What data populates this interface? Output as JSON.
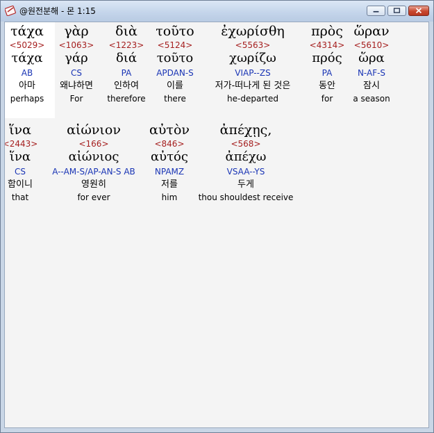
{
  "window": {
    "title": "@원전분해 - 몬 1:15",
    "controls": {
      "minimize": "minimize",
      "maximize": "maximize",
      "close": "close"
    }
  },
  "rows": [
    {
      "words": [
        {
          "greek": "τάχα",
          "strong": "<5029>",
          "lemma": "τάχα",
          "morph": "AB",
          "korean": "아마",
          "english": "perhaps"
        },
        {
          "greek": "γὰρ",
          "strong": "<1063>",
          "lemma": "γάρ",
          "morph": "CS",
          "korean": "왜냐하면",
          "english": "For"
        },
        {
          "greek": "διὰ",
          "strong": "<1223>",
          "lemma": "διά",
          "morph": "PA",
          "korean": "인하여",
          "english": "therefore"
        },
        {
          "greek": "τοῦτο",
          "strong": "<5124>",
          "lemma": "τοῦτο",
          "morph": "APDAN-S",
          "korean": "이를",
          "english": "there"
        },
        {
          "greek": "ἐχωρίσθη",
          "strong": "<5563>",
          "lemma": "χωρίζω",
          "morph": "VIAP--ZS",
          "korean": "저가-떠나게 된 것은",
          "english": "he-departed"
        },
        {
          "greek": "πρὸς",
          "strong": "<4314>",
          "lemma": "πρός",
          "morph": "PA",
          "korean": "동안",
          "english": "for"
        },
        {
          "greek": "ὥραν",
          "strong": "<5610>",
          "lemma": "ὥρα",
          "morph": "N-AF-S",
          "korean": "잠시",
          "english": "a season"
        }
      ]
    },
    {
      "words": [
        {
          "greek": "ἵνα",
          "strong": "<2443>",
          "lemma": "ἵνα",
          "morph": "CS",
          "korean": "함이니",
          "english": "that"
        },
        {
          "greek": "αἰώνιον",
          "strong": "<166>",
          "lemma": "αἰώνιος",
          "morph": "A--AM-S/AP-AN-S AB",
          "korean": "영원히",
          "english": "for ever"
        },
        {
          "greek": "αὐτὸν",
          "strong": "<846>",
          "lemma": "αὐτός",
          "morph": "NPAMZ",
          "korean": "저를",
          "english": "him"
        },
        {
          "greek": "ἀπέχῃς,",
          "strong": "<568>",
          "lemma": "ἀπέχω",
          "morph": "VSAA--YS",
          "korean": "두게",
          "english": "thou shouldest receive"
        }
      ]
    }
  ]
}
